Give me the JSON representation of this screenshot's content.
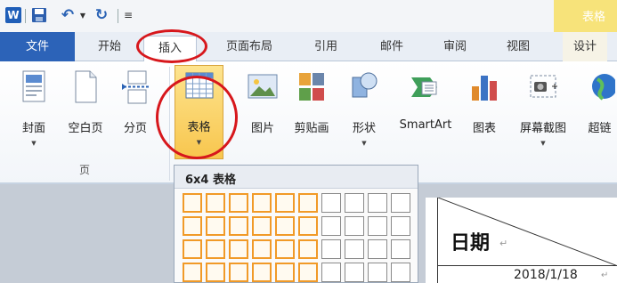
{
  "app": {
    "logo_letter": "W",
    "contextual_tab_group": "表格"
  },
  "tabs": {
    "file": "文件",
    "home": "开始",
    "insert": "插入",
    "page_layout": "页面布局",
    "references": "引用",
    "mailings": "邮件",
    "review": "审阅",
    "view": "视图",
    "design": "设计"
  },
  "ribbon": {
    "cover": "封面",
    "blank_page": "空白页",
    "page_break": "分页",
    "table": "表格",
    "picture": "图片",
    "clip_art": "剪贴画",
    "shapes": "形状",
    "smartart": "SmartArt",
    "chart": "图表",
    "screenshot": "屏幕截图",
    "hyperlink": "超链",
    "group_pages": "页"
  },
  "table_dropdown": {
    "header": "6x4 表格",
    "grid_columns": 10,
    "grid_rows_visible": 4,
    "selected_columns": 6,
    "selected_rows": 4
  },
  "document": {
    "header_label": "日期",
    "paragraph_mark": "↵",
    "date_value": "2018/1/18"
  },
  "colors": {
    "file_tab": "#2c63b8",
    "highlight_circle": "#d7171c",
    "selected_grid_cell": "#f19a28",
    "table_button_bg": "#f8c64e"
  },
  "icons": {
    "word_logo": "word-logo-icon",
    "save": "save-icon",
    "undo": "undo-icon",
    "redo": "redo-icon",
    "customize": "customize-quick-access-icon"
  }
}
